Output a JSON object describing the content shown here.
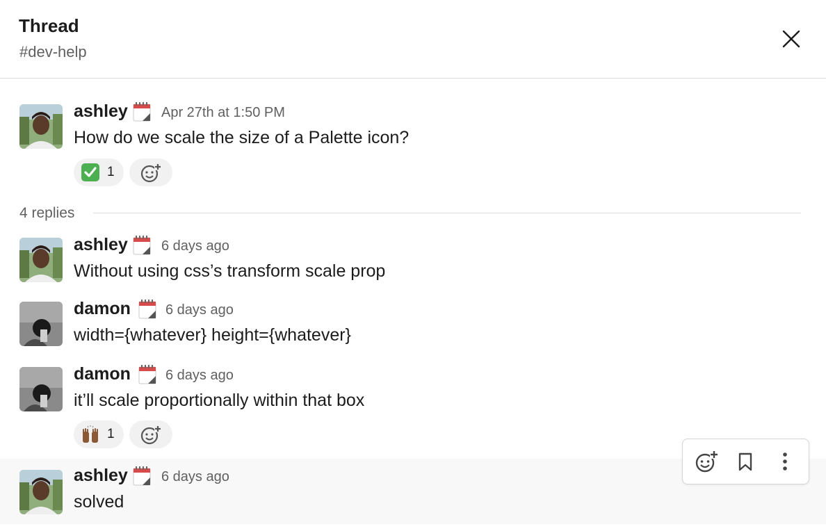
{
  "header": {
    "title": "Thread",
    "channel": "#dev-help",
    "close_icon": "close-icon"
  },
  "parent": {
    "author": "ashley",
    "status_icon": "calendar-icon",
    "time": "Apr 27th at 1:50 PM",
    "text": "How do we scale the size of a Palette icon?",
    "reaction": {
      "emoji": "white-check-mark",
      "count": "1"
    }
  },
  "replies_label": "4 replies",
  "replies": [
    {
      "author": "ashley",
      "time": "6 days ago",
      "text": "Without using css’s transform scale prop"
    },
    {
      "author": "damon",
      "time": "6 days ago",
      "text": "width={whatever} height={whatever}"
    },
    {
      "author": "damon",
      "time": "6 days ago",
      "text": "it’ll scale proportionally within that box",
      "reaction": {
        "emoji": "raised-hands",
        "count": "1"
      }
    },
    {
      "author": "ashley",
      "time": "6 days ago",
      "text": "solved"
    }
  ],
  "hover_toolbar": [
    "add-reaction-icon",
    "bookmark-icon",
    "more-actions-icon"
  ],
  "colors": {
    "muted": "#616061",
    "text": "#1d1c1d",
    "reaction_bg": "#f1f1f1",
    "hover_bg": "#f8f8f8"
  }
}
